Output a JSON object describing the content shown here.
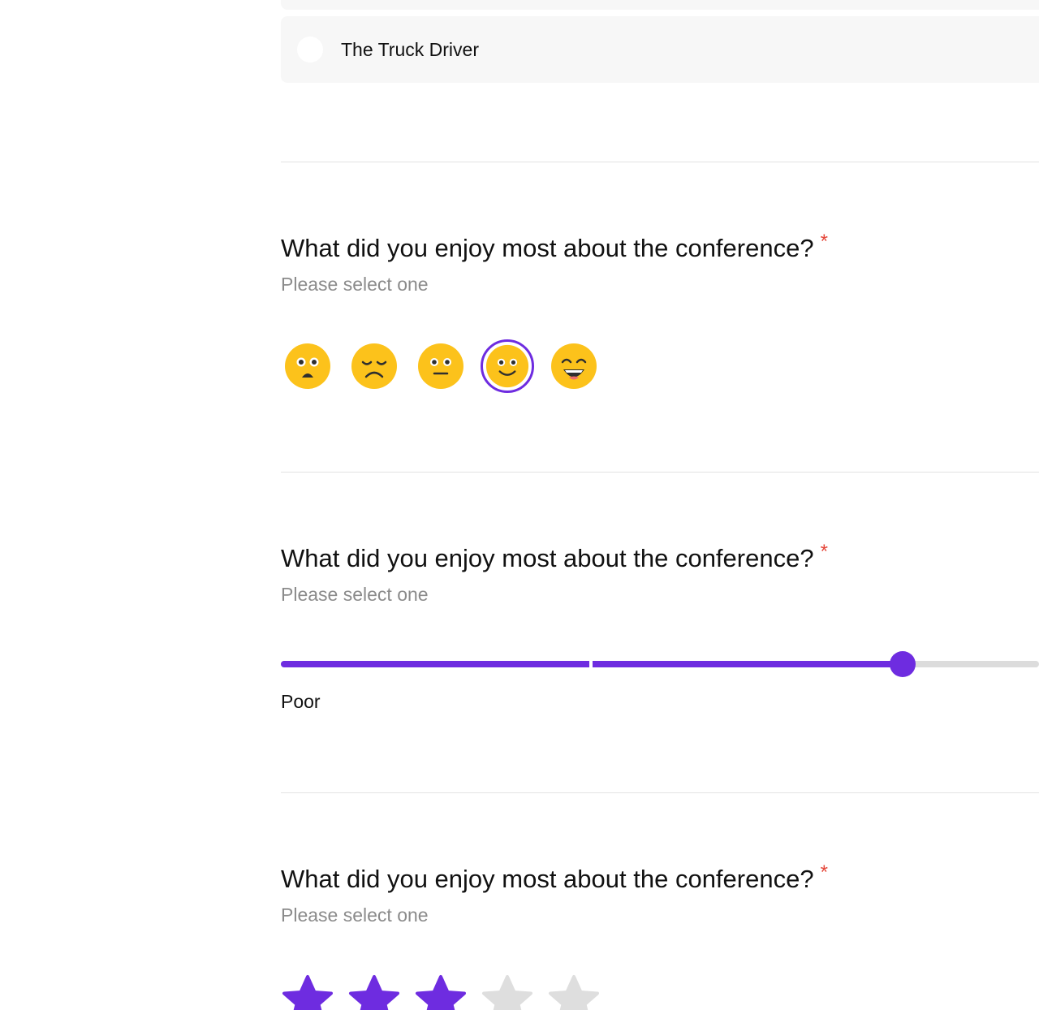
{
  "option_prev": {
    "label": ""
  },
  "option_truck": {
    "label": "The Truck Driver"
  },
  "questions": [
    {
      "title": "What did you enjoy most about the conference?",
      "required_mark": "*",
      "hint": "Please select one"
    },
    {
      "title": "What did you enjoy most about the conference?",
      "required_mark": "*",
      "hint": "Please select one"
    },
    {
      "title": "What did you enjoy most about the conference?",
      "required_mark": "*",
      "hint": "Please select one"
    }
  ],
  "emoji_rating": {
    "options": [
      "frowning-open-mouth-face-icon",
      "sad-face-icon",
      "neutral-face-icon",
      "slightly-smiling-face-icon",
      "grinning-face-icon"
    ],
    "selected_index": 3
  },
  "slider_rating": {
    "value_fraction": 0.82,
    "min_label": "Poor"
  },
  "star_rating": {
    "max": 5,
    "value": 3
  },
  "colors": {
    "accent": "#6e2ce0",
    "required": "#e5473a",
    "hint": "#8b8b8b",
    "emoji_face": "#fcc21b",
    "star_inactive": "#dedede",
    "card_bg": "#f7f7f7"
  }
}
